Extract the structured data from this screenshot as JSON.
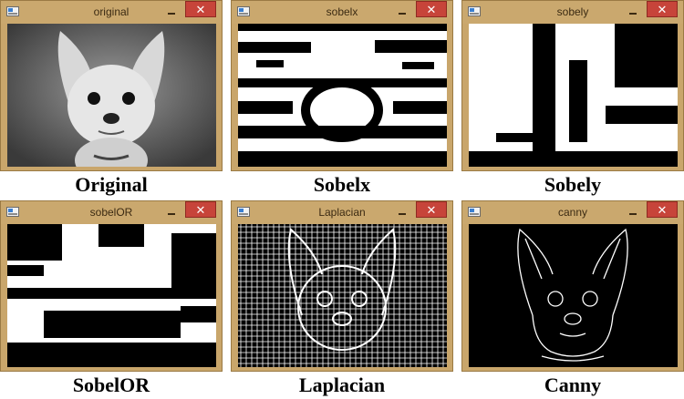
{
  "windows": [
    {
      "title": "original",
      "close_glyph": "✕",
      "caption": "Original",
      "kind": "grayscale"
    },
    {
      "title": "sobelx",
      "close_glyph": "✕",
      "caption": "Sobelx",
      "kind": "binary-sobelx"
    },
    {
      "title": "sobely",
      "close_glyph": "✕",
      "caption": "Sobely",
      "kind": "binary-sobely"
    },
    {
      "title": "sobelOR",
      "close_glyph": "✕",
      "caption": "SobelOR",
      "kind": "binary-sobelor"
    },
    {
      "title": "Laplacian",
      "close_glyph": "✕",
      "caption": "Laplacian",
      "kind": "laplacian"
    },
    {
      "title": "canny",
      "close_glyph": "✕",
      "caption": "Canny",
      "kind": "canny"
    }
  ],
  "icons": {
    "app": "window-app-icon",
    "minimize": "minimize-icon",
    "close": "close-icon"
  },
  "colors": {
    "titlebar": "#caa86e",
    "close_button": "#c7443a"
  }
}
